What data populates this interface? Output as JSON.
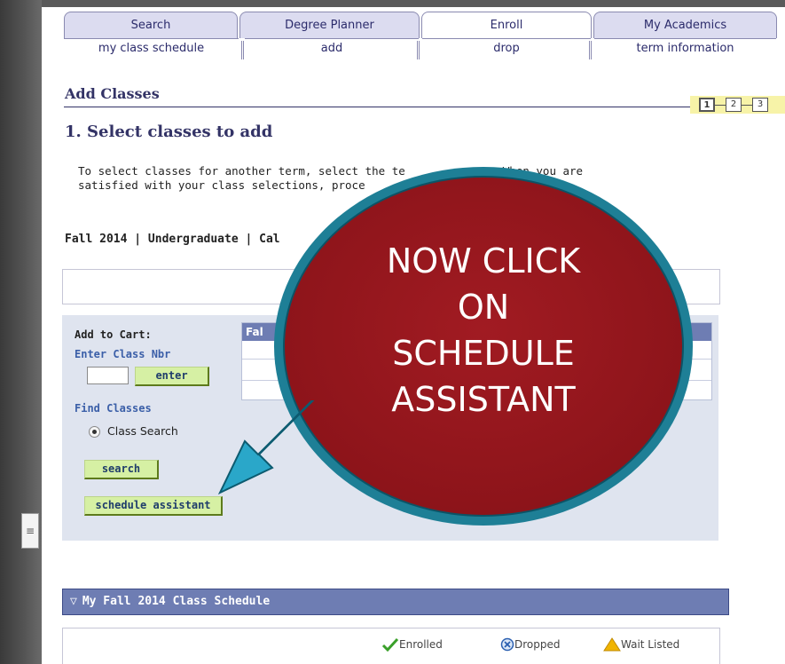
{
  "tabs": [
    {
      "label": "Search"
    },
    {
      "label": "Degree Planner"
    },
    {
      "label": "Enroll"
    },
    {
      "label": "My Academics"
    }
  ],
  "subtabs": [
    {
      "label": "my class schedule"
    },
    {
      "label": "add"
    },
    {
      "label": "drop"
    },
    {
      "label": "term information"
    }
  ],
  "page": {
    "title": "Add Classes",
    "step_heading": "1. Select classes to add",
    "instructions_line1": "To select classes for another term, select the te",
    "instructions_line1b": "When you are",
    "instructions_line2": "satisfied with your class selections, proce",
    "term_line": "Fall 2014 | Undergraduate | Cal",
    "steps": [
      "1",
      "2",
      "3"
    ]
  },
  "cart": {
    "add_to_cart_label": "Add to Cart:",
    "enter_class_nbr_label": "Enter Class Nbr",
    "class_nbr_value": "",
    "enter_button": "enter",
    "find_classes_label": "Find Classes",
    "class_search_radio": "Class Search",
    "search_button": "search",
    "schedule_assistant_button": "schedule assistant",
    "table_header": "Fal"
  },
  "schedule": {
    "header": "My Fall 2014 Class Schedule",
    "legend": [
      {
        "label": "Enrolled",
        "icon": "check-icon",
        "color": "#3aa02a"
      },
      {
        "label": "Dropped",
        "icon": "x-circle-icon",
        "color": "#2a5fb0"
      },
      {
        "label": "Wait Listed",
        "icon": "warning-triangle-icon",
        "color": "#f0b400"
      }
    ]
  },
  "callout": {
    "lines": [
      "NOW CLICK",
      "ON",
      "SCHEDULE",
      "ASSISTANT"
    ],
    "fill_color": "#9b1820",
    "ring_color": "#1e7f96",
    "arrow_color": "#2aa7c9"
  }
}
